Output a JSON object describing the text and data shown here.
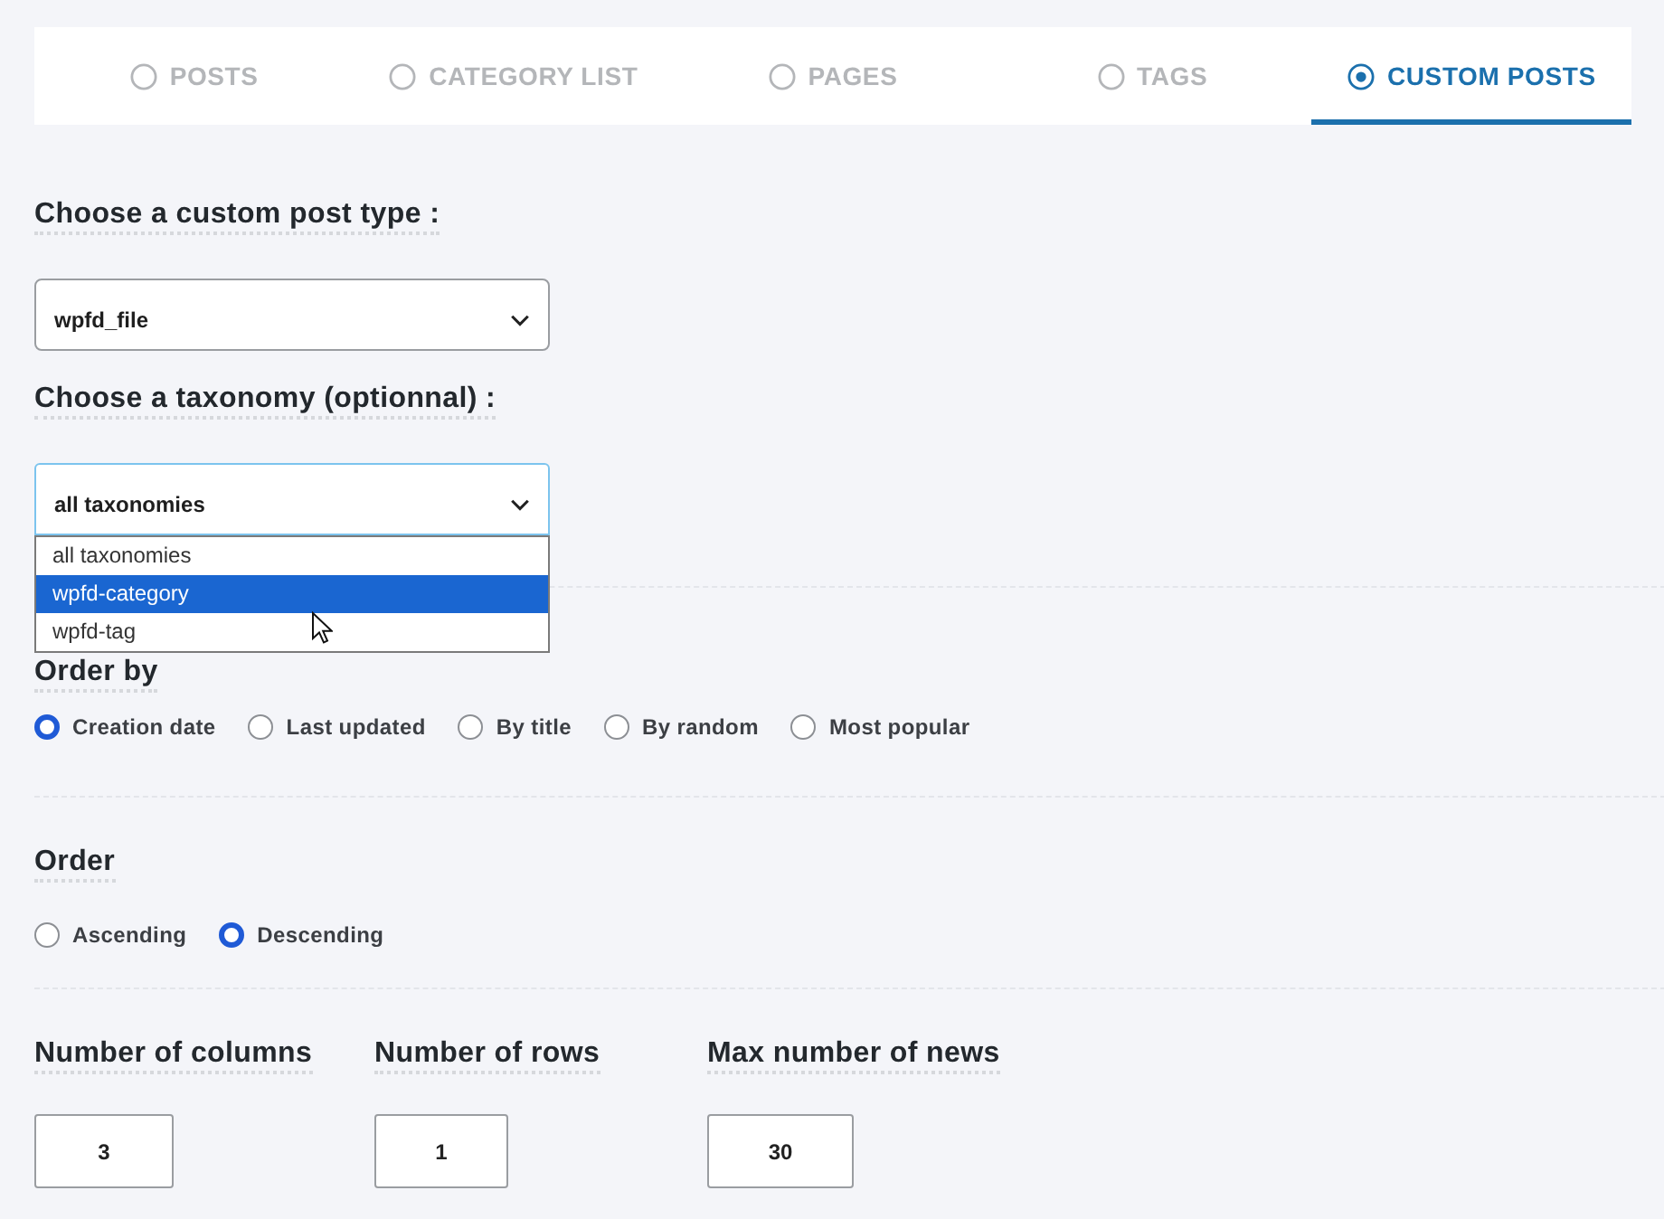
{
  "tabs": [
    {
      "label": "POSTS",
      "selected": false
    },
    {
      "label": "CATEGORY LIST",
      "selected": false
    },
    {
      "label": "PAGES",
      "selected": false
    },
    {
      "label": "TAGS",
      "selected": false
    },
    {
      "label": "CUSTOM POSTS",
      "selected": true
    }
  ],
  "post_type": {
    "label": "Choose a custom post type :",
    "value": "wpfd_file",
    "expanded": false
  },
  "taxonomy": {
    "label": "Choose a taxonomy (optionnal) :",
    "value": "all taxonomies",
    "expanded": true,
    "options": [
      {
        "label": "all taxonomies",
        "highlighted": false
      },
      {
        "label": "wpfd-category",
        "highlighted": true
      },
      {
        "label": "wpfd-tag",
        "highlighted": false
      }
    ]
  },
  "order_by": {
    "label": "Order by",
    "options": [
      {
        "label": "Creation date",
        "selected": true
      },
      {
        "label": "Last updated",
        "selected": false
      },
      {
        "label": "By title",
        "selected": false
      },
      {
        "label": "By random",
        "selected": false
      },
      {
        "label": "Most popular",
        "selected": false
      }
    ]
  },
  "order": {
    "label": "Order",
    "options": [
      {
        "label": "Ascending",
        "selected": false
      },
      {
        "label": "Descending",
        "selected": true
      }
    ]
  },
  "numbers": [
    {
      "label": "Number of columns",
      "value": "3"
    },
    {
      "label": "Number of rows",
      "value": "1"
    },
    {
      "label": "Max number of news",
      "value": "30"
    }
  ]
}
